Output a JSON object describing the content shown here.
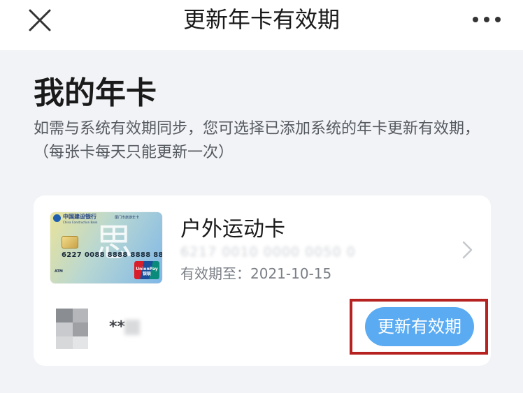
{
  "nav": {
    "title": "更新年卡有效期",
    "close_icon": "close-icon",
    "more_icon": "more-icon"
  },
  "main": {
    "title": "我的年卡",
    "description": "如需与系统有效期同步，您可选择已添加系统的年卡更新有效期，（每张卡每天只能更新一次）"
  },
  "card": {
    "bank_name": "中国建设银行",
    "bank_name_en": "China Construction Bank",
    "card_tag": "厦门市旅游年卡",
    "card_art": "思",
    "card_image_number": "6227 0088 8888 8888 888",
    "atm_label": "ATM",
    "unionpay_label": "UnionPay 银联",
    "name": "户外运动卡",
    "masked_number": "6217 0010 0000 0050 0",
    "expiry": "有效期至：2021-10-15",
    "chevron_icon": "chevron-right-icon"
  },
  "user": {
    "name": "**"
  },
  "actions": {
    "update_label": "更新有效期"
  },
  "colors": {
    "accent": "#5aabf2",
    "highlight": "#b5221f",
    "background": "#f2f3f7"
  }
}
